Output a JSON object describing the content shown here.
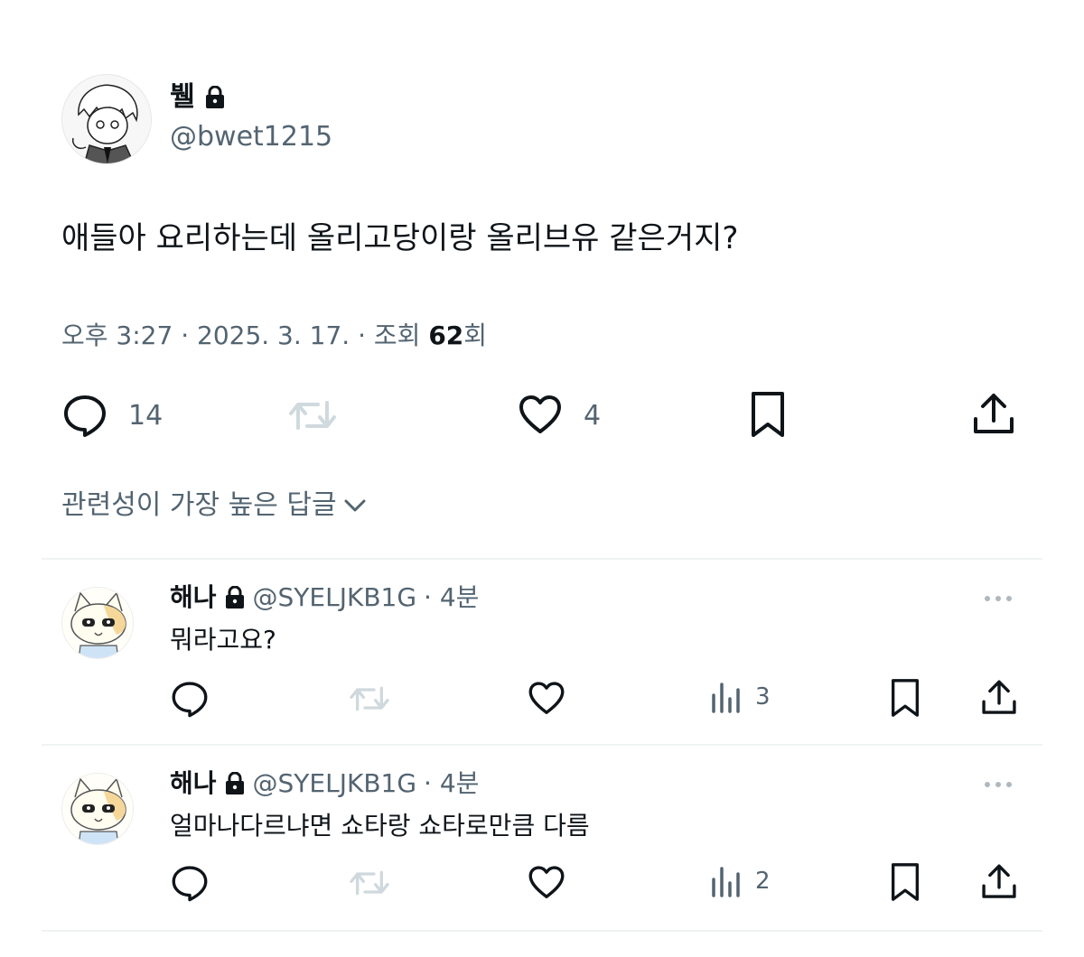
{
  "tweet": {
    "display_name": "뷀",
    "handle": "@bwet1215",
    "text": "애들아 요리하는데 올리고당이랑 올리브유 같은거지?",
    "time": "오후 3:27 · 2025. 3. 17. · 조회 ",
    "views": "62",
    "views_suffix": "회",
    "replies": "14",
    "likes": "4"
  },
  "relevance_label": "관련성이 가장 높은 답글",
  "replies": [
    {
      "name": "해나",
      "handle": "@SYELJKB1G",
      "time": "· 4분",
      "text": "뭐라고요?",
      "views": "3"
    },
    {
      "name": "해나",
      "handle": "@SYELJKB1G",
      "time": "· 4분",
      "text": "얼마나다르냐면 쇼타랑 쇼타로만큼 다름",
      "views": "2"
    }
  ],
  "colors": {
    "text": "#0f1419",
    "muted": "#536471",
    "disabled": "#cfd9de",
    "divider": "#eff3f4"
  }
}
